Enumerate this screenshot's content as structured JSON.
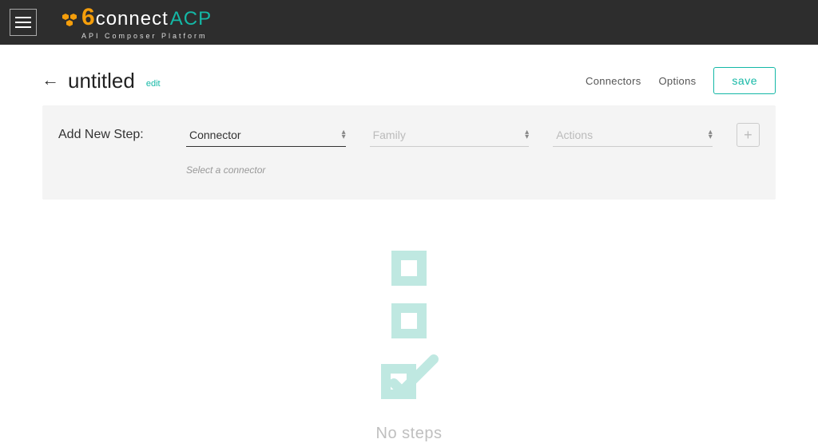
{
  "brand": {
    "six": "6",
    "connect": "connect",
    "acp": "ACP",
    "subtitle": "API Composer Platform"
  },
  "page": {
    "title": "untitled",
    "edit_label": "edit"
  },
  "nav": {
    "connectors": "Connectors",
    "options": "Options",
    "save": "save"
  },
  "add_step": {
    "label": "Add New Step:",
    "connector": "Connector",
    "family": "Family",
    "actions": "Actions",
    "helper": "Select a connector"
  },
  "empty": {
    "message": "No steps"
  }
}
